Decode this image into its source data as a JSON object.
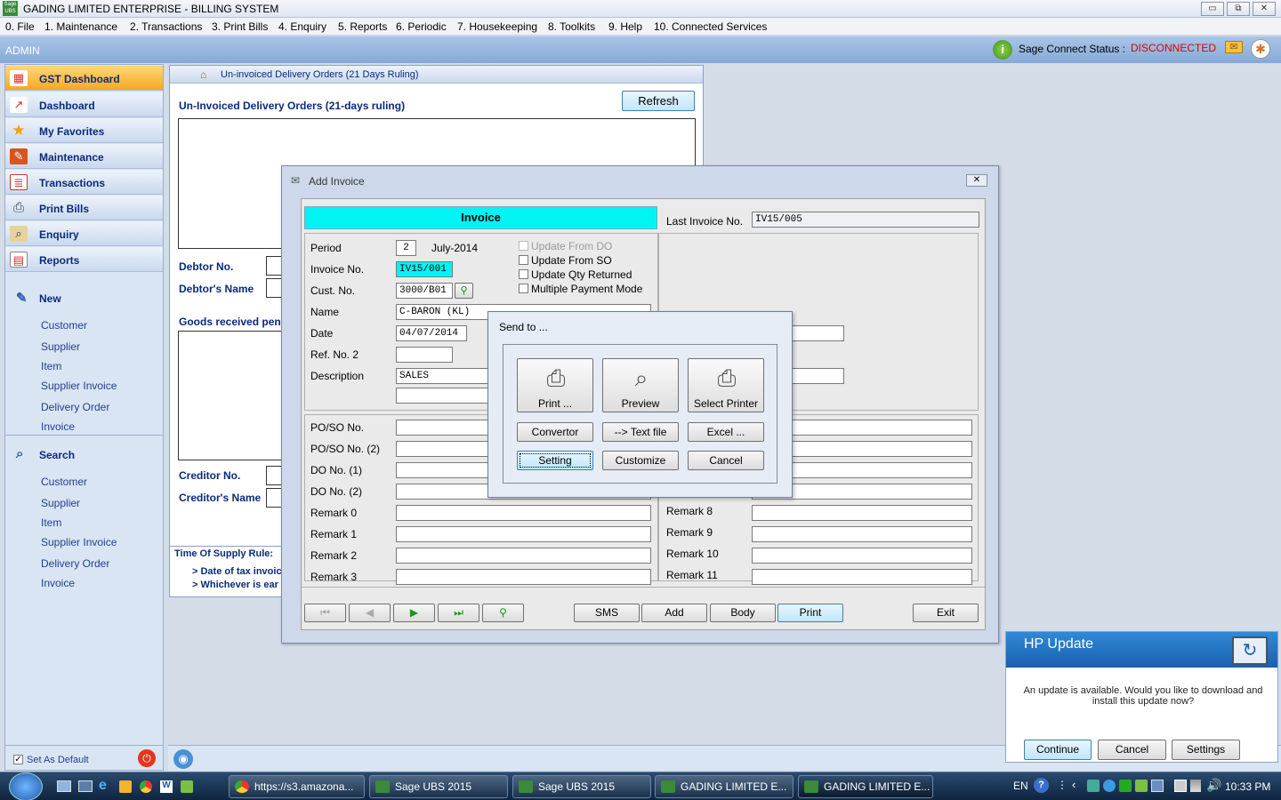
{
  "window": {
    "title": "GADING LIMITED ENTERPRISE - BILLING SYSTEM",
    "min": "▭",
    "max": "⧉",
    "close": "✕"
  },
  "menu": [
    "0. File",
    "1. Maintenance",
    "2. Transactions",
    "3. Print Bills",
    "4. Enquiry",
    "5. Reports",
    "6. Periodic",
    "7. Housekeeping",
    "8. Toolkits",
    "9. Help",
    "10. Connected Services"
  ],
  "header": {
    "user": "ADMIN",
    "connect_label": "Sage Connect Status :",
    "connect_status": "DISCONNECTED",
    "status_color": "#e00000"
  },
  "sidebar": {
    "nav": [
      {
        "label": "GST Dashboard",
        "icon": "gst-dashboard-icon"
      },
      {
        "label": "Dashboard",
        "icon": "dashboard-icon"
      },
      {
        "label": "My Favorites",
        "icon": "star-icon"
      },
      {
        "label": "Maintenance",
        "icon": "wrench-icon"
      },
      {
        "label": "Transactions",
        "icon": "transactions-icon"
      },
      {
        "label": "Print Bills",
        "icon": "printer-icon"
      },
      {
        "label": "Enquiry",
        "icon": "magnifier-icon"
      },
      {
        "label": "Reports",
        "icon": "report-icon"
      }
    ],
    "new_title": "New",
    "new_items": [
      "Customer",
      "Supplier",
      "Item",
      "Supplier Invoice",
      "Delivery Order",
      "Invoice"
    ],
    "search_title": "Search",
    "search_items": [
      "Customer",
      "Supplier",
      "Item",
      "Supplier Invoice",
      "Delivery Order",
      "Invoice"
    ],
    "set_default": "Set As Default"
  },
  "bg_panel": {
    "tab_title": "Un-invoiced Delivery Orders (21 Days Ruling)",
    "heading": "Un-Invoiced Delivery Orders (21-days ruling)",
    "refresh": "Refresh",
    "debtor_no": "Debtor No.",
    "debtor_name": "Debtor's Name",
    "goods": "Goods received pend",
    "creditor_no": "Creditor No.",
    "creditor_name": "Creditor's Name",
    "supply_rule": "Time Of Supply Rule:",
    "rule1": "> Date of tax invoic",
    "rule2": "> Whichever is ear"
  },
  "invoice_dialog": {
    "title": "Add Invoice",
    "banner": "Invoice",
    "last_invoice_label": "Last Invoice No.",
    "last_invoice": "IV15/005",
    "period_label": "Period",
    "period": "2",
    "period_month": "July-2014",
    "invoice_no_label": "Invoice No.",
    "invoice_no": "IV15/001",
    "cust_no_label": "Cust. No.",
    "cust_no": "3000/B01",
    "name_label": "Name",
    "name": "C-BARON (KL)",
    "date_label": "Date",
    "date": "04/07/2014",
    "ref2_label": "Ref. No. 2",
    "ref2": "",
    "desc_label": "Description",
    "desc": "SALES",
    "checks": [
      "Update From DO",
      "Update From SO",
      "Update Qty Returned",
      "Multiple Payment Mode"
    ],
    "left_fields": [
      "PO/SO No.",
      "PO/SO No. (2)",
      "DO No. (1)",
      "DO No. (2)",
      "Remark 0",
      "Remark 1",
      "Remark 2",
      "Remark 3"
    ],
    "right_fields": [
      "Remark 8",
      "Remark 9",
      "Remark 10",
      "Remark 11"
    ],
    "buttons": {
      "sms": "SMS",
      "add": "Add",
      "body": "Body",
      "print": "Print",
      "exit": "Exit"
    }
  },
  "send_to": {
    "title": "Send to ...",
    "print": "Print ...",
    "preview": "Preview",
    "select_printer": "Select Printer",
    "convertor": "Convertor",
    "text_file": "--> Text file",
    "excel": "Excel ...",
    "setting": "Setting",
    "customize": "Customize",
    "cancel": "Cancel"
  },
  "hp_update": {
    "title": "HP Update",
    "message": "An update is available. Would you like to download and install this update now?",
    "continue": "Continue",
    "cancel": "Cancel",
    "settings": "Settings"
  },
  "taskbar": {
    "tasks": [
      "https://s3.amazona...",
      "Sage UBS 2015",
      "Sage UBS 2015",
      "GADING LIMITED E...",
      "GADING LIMITED E..."
    ],
    "lang": "EN",
    "time": "10:33 PM"
  }
}
